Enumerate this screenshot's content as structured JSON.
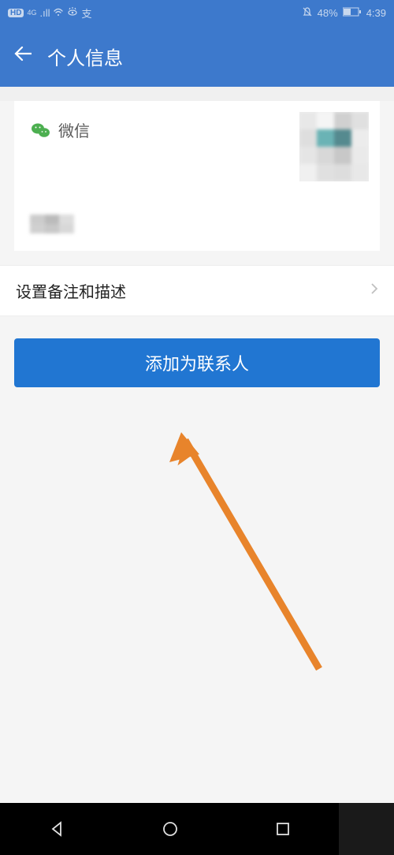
{
  "status": {
    "hd": "HD",
    "network": "4G",
    "battery_pct": "48%",
    "time": "4:39"
  },
  "header": {
    "title": "个人信息"
  },
  "profile": {
    "source_label": "微信"
  },
  "settings": {
    "remark_label": "设置备注和描述"
  },
  "actions": {
    "add_contact": "添加为联系人"
  },
  "colors": {
    "primary": "#3d79cc",
    "button": "#2176d2",
    "annotation": "#e8842b"
  }
}
